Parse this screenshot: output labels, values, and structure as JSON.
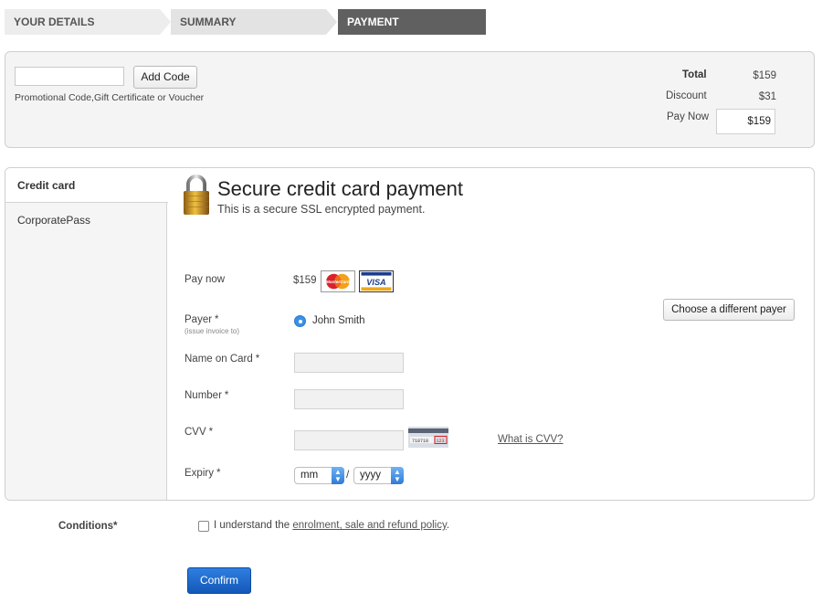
{
  "steps": [
    "YOUR DETAILS",
    "SUMMARY",
    "PAYMENT"
  ],
  "promo": {
    "input_value": "",
    "add_code_label": "Add Code",
    "help_text": "Promotional Code,Gift Certificate or Voucher"
  },
  "summary": {
    "total_label": "Total",
    "total_value": "$159",
    "discount_label": "Discount",
    "discount_value": "$31",
    "pay_now_label": "Pay Now",
    "pay_now_value": "$159"
  },
  "tabs": {
    "credit_card": "Credit card",
    "corporate_pass": "CorporatePass"
  },
  "payment": {
    "title": "Secure credit card payment",
    "subtitle": "This is a secure SSL encrypted payment.",
    "pay_now_label": "Pay now",
    "amount": "$159",
    "payer_label": "Payer",
    "payer_note": "(issue invoice to)",
    "payer_name": "John Smith",
    "choose_payer_label": "Choose a different payer",
    "name_on_card_label": "Name on Card",
    "number_label": "Number",
    "cvv_label": "CVV",
    "what_is_cvv": "What is CVV?",
    "expiry_label": "Expiry",
    "month_selected": "mm",
    "year_selected": "yyyy",
    "required_mark": "*",
    "cards": [
      "MasterCard",
      "VISA"
    ],
    "cvv_sample": "718718",
    "cvv_sample_code": "123"
  },
  "conditions": {
    "label": "Conditions",
    "text_prefix": "I understand the ",
    "link_text": "enrolment, sale and refund policy",
    "text_suffix": "."
  },
  "confirm_label": "Confirm",
  "colors": {
    "active_step": "#606060",
    "accent_blue": "#2f7bd6",
    "panel_bg": "#f4f4f4"
  }
}
